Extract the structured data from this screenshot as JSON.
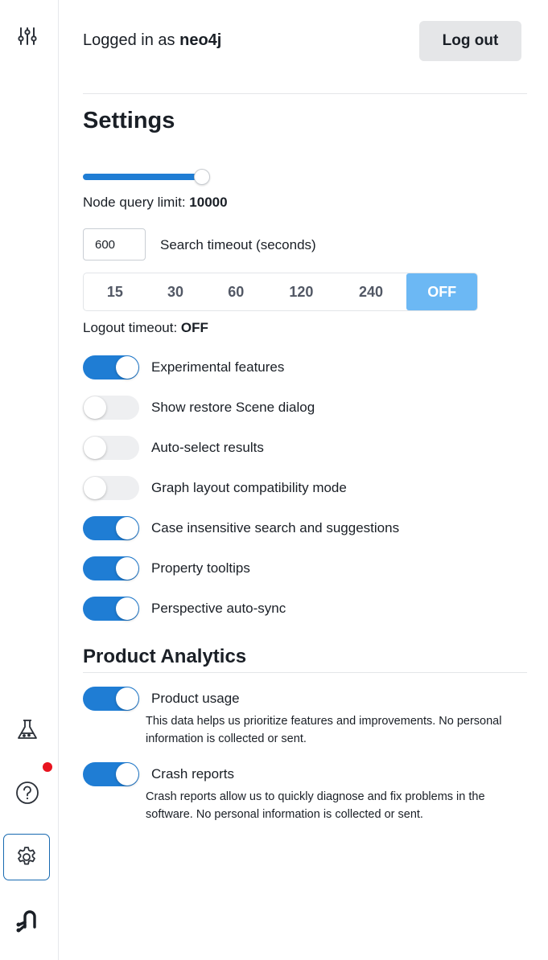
{
  "sidebar": {
    "icons": [
      {
        "name": "filter-sliders-icon"
      },
      {
        "name": "flask-icon"
      },
      {
        "name": "help-icon"
      },
      {
        "name": "gear-icon"
      },
      {
        "name": "neo4j-logo-icon"
      }
    ],
    "notification_color": "#e8141f"
  },
  "header": {
    "logged_in_prefix": "Logged in as ",
    "username": "neo4j",
    "logout_label": "Log out"
  },
  "settings": {
    "title": "Settings",
    "node_query_limit": {
      "label": "Node query limit: ",
      "value": "10000",
      "slider_fill_fraction": 0.93
    },
    "search_timeout": {
      "value": "600",
      "label": "Search timeout (seconds)"
    },
    "logout_timeout_options": [
      "15",
      "30",
      "60",
      "120",
      "240",
      "OFF"
    ],
    "logout_timeout_selected": "OFF",
    "logout_timeout": {
      "label": "Logout timeout: ",
      "value": "OFF"
    },
    "toggles": [
      {
        "label": "Experimental features",
        "on": true
      },
      {
        "label": "Show restore Scene dialog",
        "on": false
      },
      {
        "label": "Auto-select results",
        "on": false
      },
      {
        "label": "Graph layout compatibility mode",
        "on": false
      },
      {
        "label": "Case insensitive search and suggestions",
        "on": true
      },
      {
        "label": "Property tooltips",
        "on": true
      },
      {
        "label": "Perspective auto-sync",
        "on": true
      }
    ]
  },
  "analytics": {
    "title": "Product Analytics",
    "items": [
      {
        "label": "Product usage",
        "on": true,
        "description": "This data helps us prioritize features and improvements. No personal information is collected or sent."
      },
      {
        "label": "Crash reports",
        "on": true,
        "description": "Crash reports allow us to quickly diagnose and fix problems in the software. No personal information is collected or sent."
      }
    ]
  },
  "colors": {
    "accent": "#1f7dd4",
    "segment_active": "#6cb8f4",
    "toggle_off": "#eeeff1",
    "button_bg": "#e5e6e8"
  }
}
